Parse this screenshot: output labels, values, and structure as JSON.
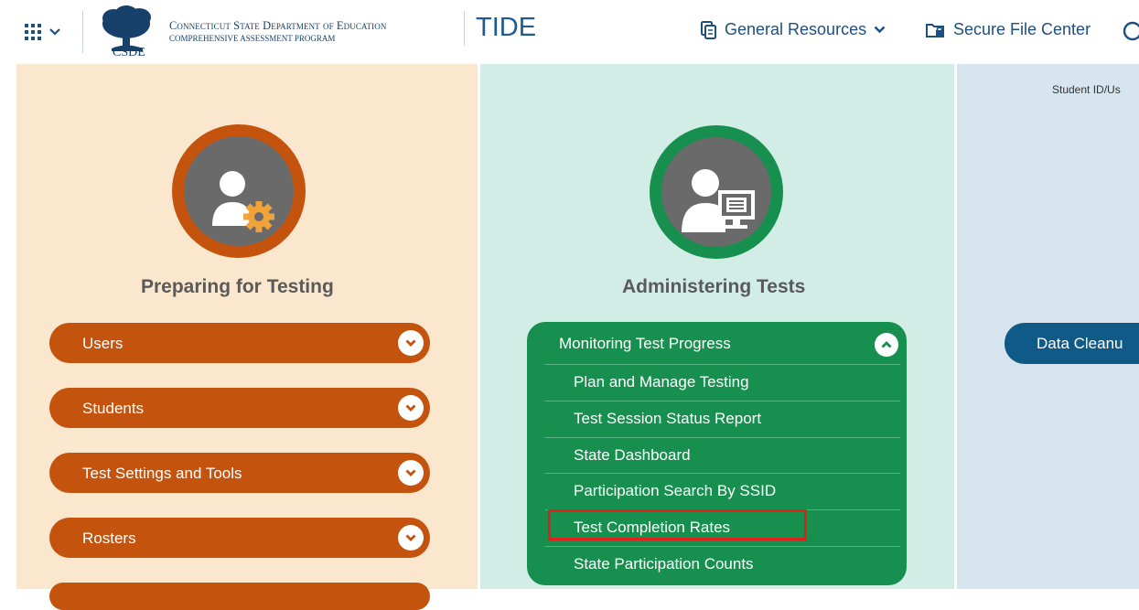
{
  "header": {
    "org_line1": "Connecticut State Department of Education",
    "org_line2": "COMPREHENSIVE ASSESSMENT PROGRAM",
    "logo_text": "CSDE",
    "app_name": "TIDE",
    "nav": [
      {
        "label": "General Resources",
        "icon": "document-copy-icon"
      },
      {
        "label": "Secure File Center",
        "icon": "locked-folder-icon"
      }
    ]
  },
  "columns": {
    "preparing": {
      "title": "Preparing for Testing",
      "icon": "user-gear-icon",
      "items": [
        "Users",
        "Students",
        "Test Settings and Tools",
        "Rosters"
      ]
    },
    "administering": {
      "title": "Administering Tests",
      "icon": "user-monitor-icon",
      "expanded": {
        "label": "Monitoring Test Progress",
        "items": [
          "Plan and Manage Testing",
          "Test Session Status Report",
          "State Dashboard",
          "Participation Search By SSID",
          "Test Completion Rates",
          "State Participation Counts"
        ],
        "highlighted": "Test Completion Rates"
      }
    },
    "third": {
      "student_id_label": "Student ID/Us",
      "button": "Data Cleanu"
    }
  },
  "colors": {
    "preparing_bg": "#fbe7cd",
    "preparing_accent": "#c4530e",
    "administering_bg": "#d2ede5",
    "administering_accent": "#168f4f",
    "third_bg": "#d6e5ee",
    "third_accent": "#0f5a87",
    "highlight": "#e0201c",
    "header_text": "#1d4f80"
  }
}
